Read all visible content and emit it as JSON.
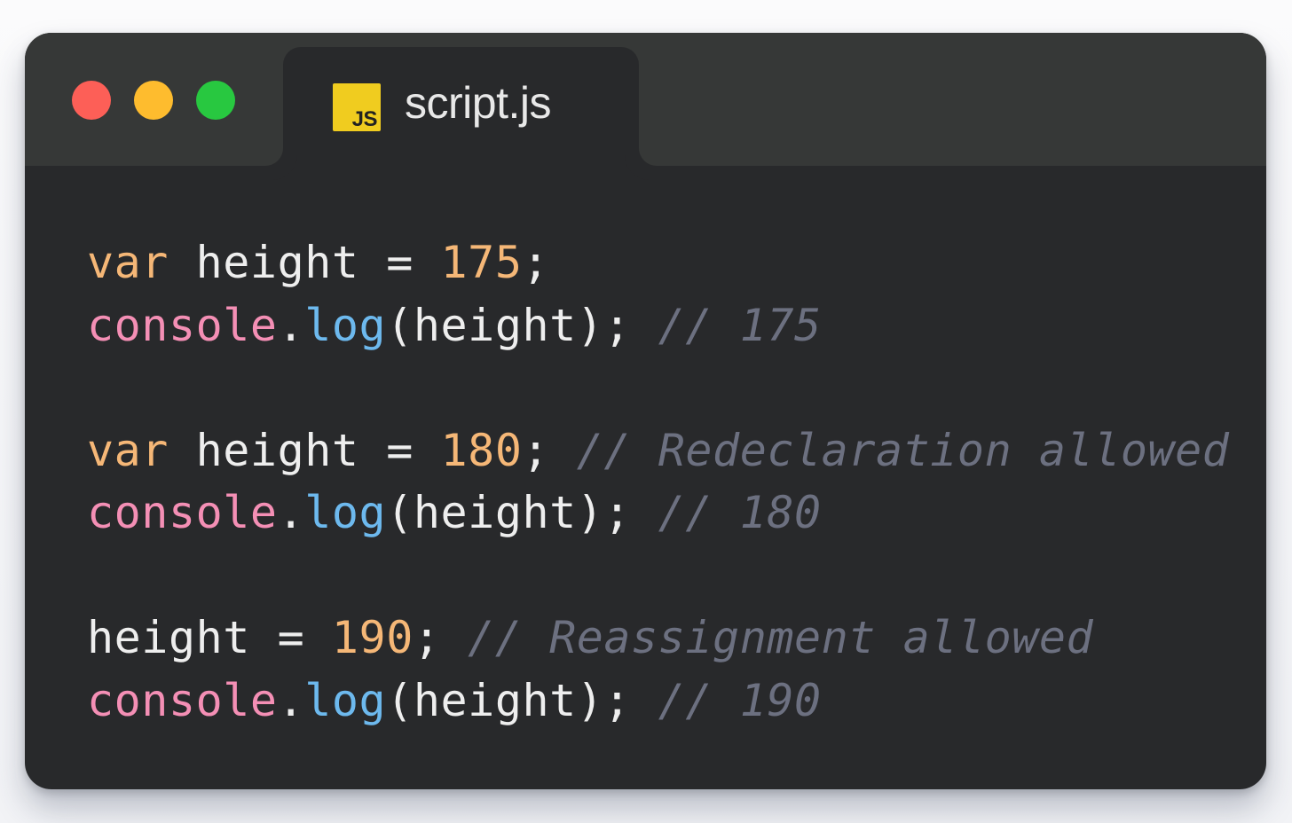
{
  "window": {
    "traffic_lights": [
      "close",
      "minimize",
      "maximize"
    ],
    "tab": {
      "icon": "js-file-icon",
      "icon_text": "JS",
      "title": "script.js"
    }
  },
  "colors": {
    "background": "#28292b",
    "titlebar": "#363837",
    "keyword": "#f5b777",
    "number": "#f5b777",
    "object": "#f48fb5",
    "function": "#6db9ee",
    "comment": "#6c7080",
    "text": "#eeeeee"
  },
  "code": {
    "l1": {
      "kw": "var",
      "ident": "height",
      "op": "=",
      "num": "175",
      "end": ";"
    },
    "l2": {
      "obj": "console",
      "dot": ".",
      "fn": "log",
      "args": "(height);",
      "comment": "// 175"
    },
    "l4": {
      "kw": "var",
      "ident": "height",
      "op": "=",
      "num": "180",
      "end": ";",
      "comment": "// Redeclaration allowed"
    },
    "l5": {
      "obj": "console",
      "dot": ".",
      "fn": "log",
      "args": "(height);",
      "comment": "// 180"
    },
    "l7": {
      "ident": "height",
      "op": "=",
      "num": "190",
      "end": ";",
      "comment": "// Reassignment allowed"
    },
    "l8": {
      "obj": "console",
      "dot": ".",
      "fn": "log",
      "args": "(height);",
      "comment": "// 190"
    }
  }
}
